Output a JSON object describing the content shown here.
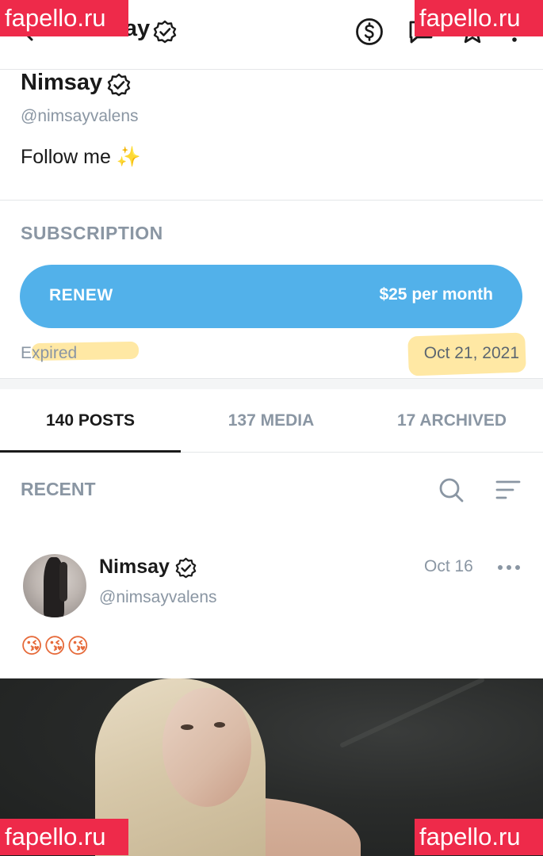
{
  "header": {
    "title": "Nimsay",
    "icons": [
      "back-arrow-icon",
      "dollar-icon",
      "message-icon",
      "star-icon",
      "more-vertical-icon"
    ]
  },
  "profile": {
    "name": "Nimsay",
    "handle": "@nimsayvalens",
    "bio_text": "Follow me",
    "bio_emoji": "✨"
  },
  "subscription": {
    "label": "SUBSCRIPTION",
    "button_label": "RENEW",
    "price": "$25 per month",
    "status": "Expired",
    "date": "Oct 21, 2021",
    "button_color": "#52b1ea"
  },
  "tabs": [
    {
      "label": "140 POSTS",
      "active": true
    },
    {
      "label": "137 MEDIA",
      "active": false
    },
    {
      "label": "17 ARCHIVED",
      "active": false
    }
  ],
  "feed": {
    "section_label": "RECENT"
  },
  "post": {
    "author": "Nimsay",
    "handle": "@nimsayvalens",
    "date": "Oct 16",
    "text": "😘😘😘"
  },
  "watermark": "fapello.ru"
}
